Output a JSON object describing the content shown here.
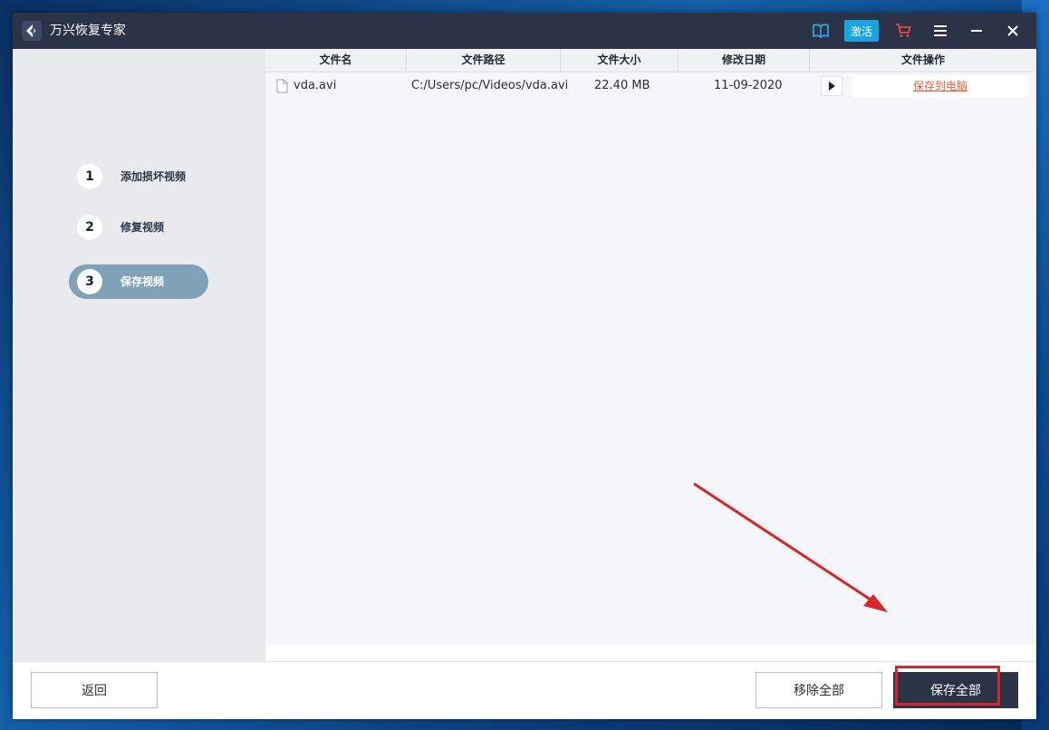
{
  "app": {
    "title": "万兴恢复专家"
  },
  "titlebar": {
    "activate_label": "激活"
  },
  "steps": [
    {
      "number": "1",
      "label": "添加损坏视频"
    },
    {
      "number": "2",
      "label": "修复视频"
    },
    {
      "number": "3",
      "label": "保存视频"
    }
  ],
  "table": {
    "columns": [
      "文件名",
      "文件路径",
      "文件大小",
      "修改日期",
      "文件操作"
    ],
    "rows": [
      {
        "name": "vda.avi",
        "path": "C:/Users/pc/Videos/vda.avi",
        "size": "22.40 MB",
        "date": "11-09-2020",
        "action": "保存到电脑"
      }
    ]
  },
  "footer": {
    "back_label": "返回",
    "remove_all_label": "移除全部",
    "save_all_label": "保存全部"
  },
  "colors": {
    "titlebar": "#2b3346",
    "accent": "#19a3e0",
    "active_step": "#7fa2b8",
    "link": "#e0603c",
    "highlight": "#d9252a"
  }
}
